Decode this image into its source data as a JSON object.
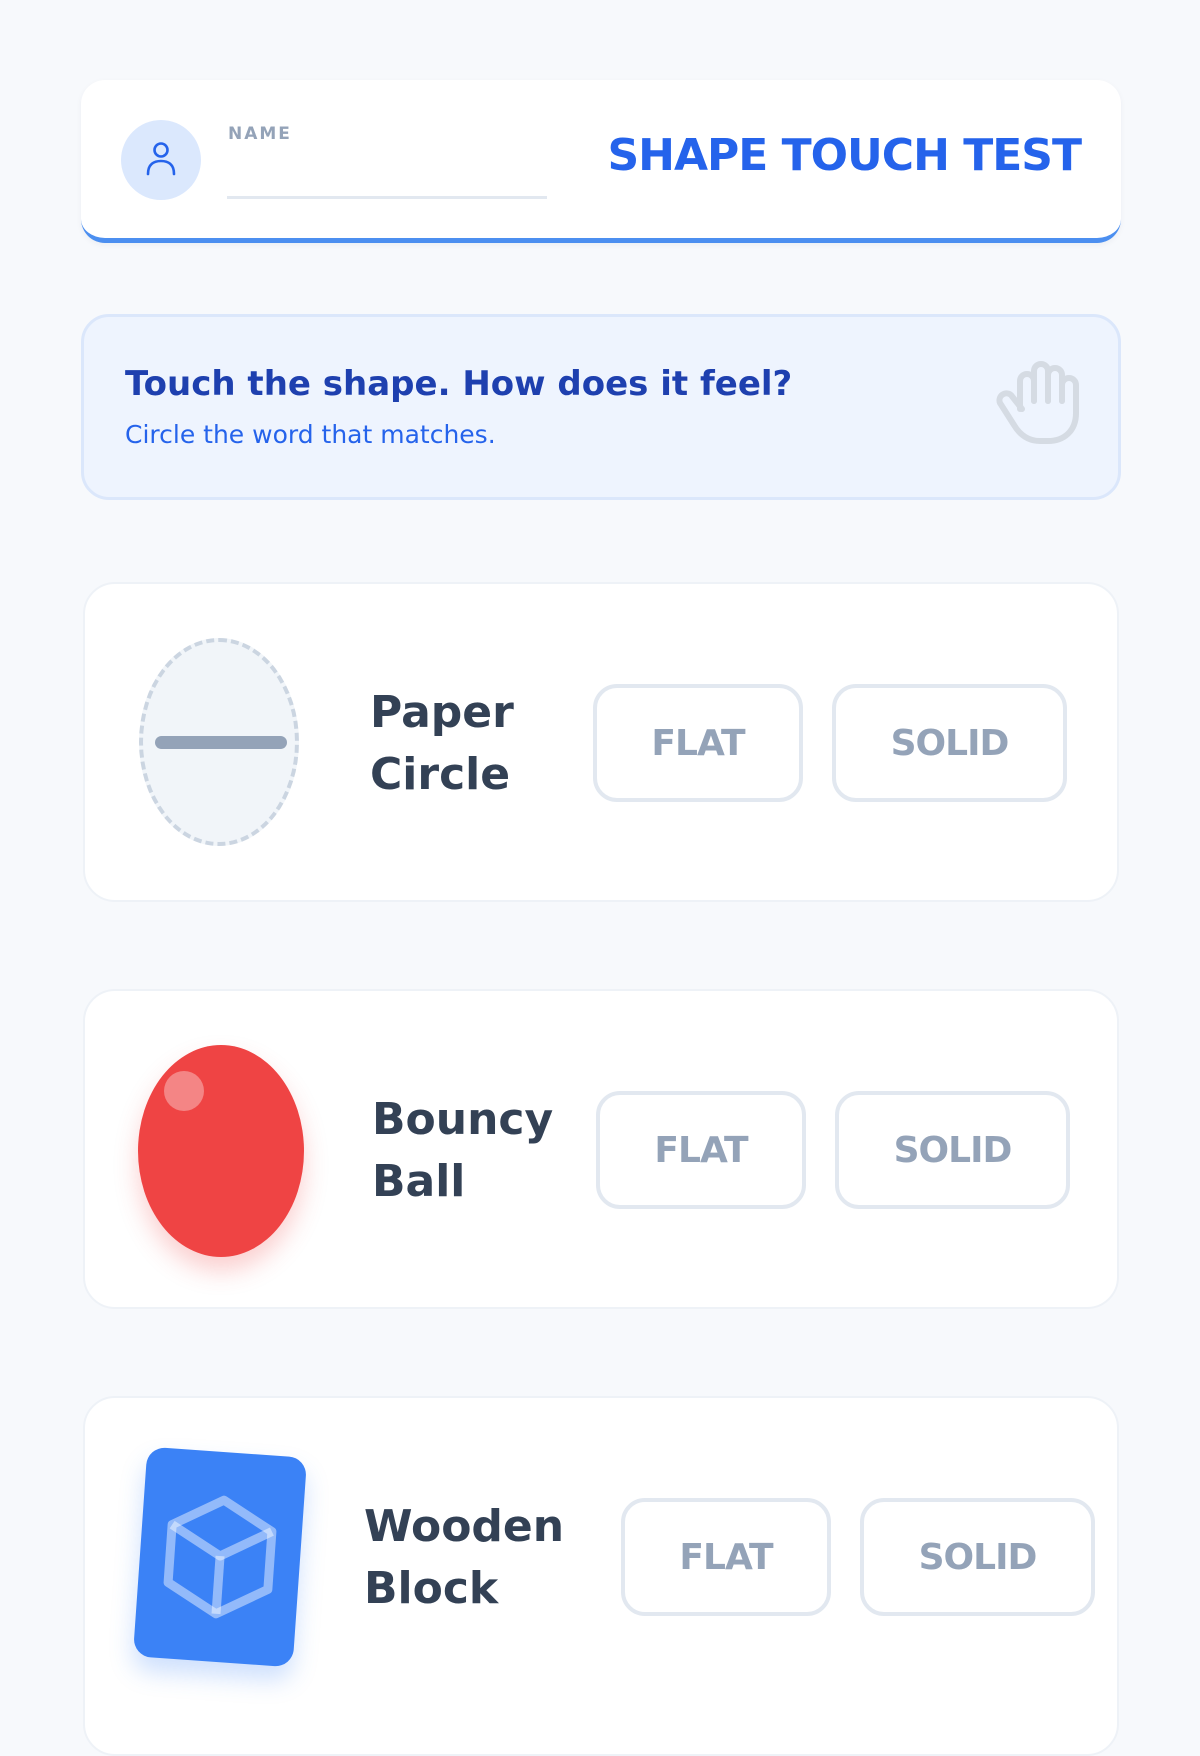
{
  "header": {
    "name_label": "NAME",
    "name_value": "",
    "title": "SHAPE TOUCH TEST",
    "avatar_icon": "user-icon"
  },
  "instruction": {
    "title": "Touch the shape. How does it feel?",
    "subtitle": "Circle the word that matches.",
    "icon": "hand-icon"
  },
  "shapes": [
    {
      "name": "Paper Circle",
      "visual": "paper-circle-icon",
      "color": "#f1f5f9",
      "options": [
        "FLAT",
        "SOLID"
      ]
    },
    {
      "name": "Bouncy Ball",
      "visual": "ball-icon",
      "color": "#ef4444",
      "options": [
        "FLAT",
        "SOLID"
      ]
    },
    {
      "name": "Wooden Block",
      "visual": "cube-icon",
      "color": "#3b82f6",
      "options": [
        "FLAT",
        "SOLID"
      ]
    }
  ],
  "colors": {
    "accent": "#2563eb",
    "header_border": "#4c8ff0",
    "option_border": "#e2e8f0",
    "option_text": "#94a3b8"
  }
}
